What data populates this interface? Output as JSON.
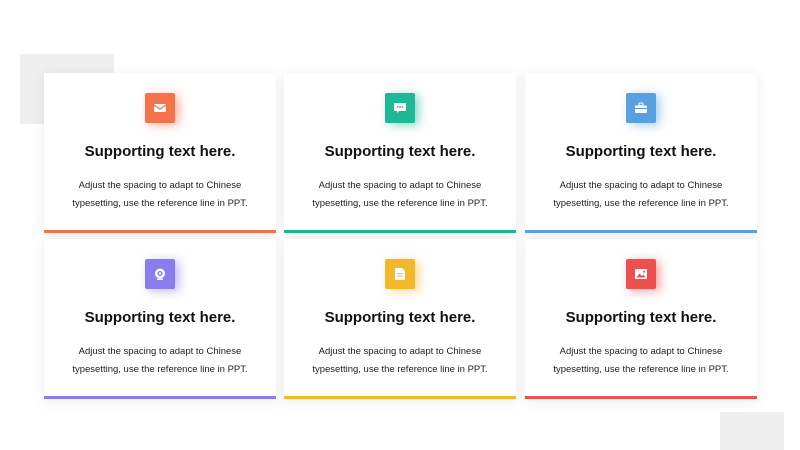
{
  "cards": [
    {
      "title": "Supporting text here.",
      "body": "Adjust the spacing to adapt to Chinese typesetting, use the reference line in PPT.",
      "icon": "envelope-icon",
      "color": "#F4734A"
    },
    {
      "title": "Supporting text here.",
      "body": "Adjust the spacing to adapt to Chinese typesetting, use the reference line in PPT.",
      "icon": "chat-bubble-icon",
      "color": "#1EB894"
    },
    {
      "title": "Supporting text here.",
      "body": "Adjust the spacing to adapt to Chinese typesetting, use the reference line in PPT.",
      "icon": "briefcase-icon",
      "color": "#5A9FE0"
    },
    {
      "title": "Supporting text here.",
      "body": "Adjust the spacing to adapt to Chinese typesetting, use the reference line in PPT.",
      "icon": "camera-icon",
      "color": "#8B7CEE"
    },
    {
      "title": "Supporting text here.",
      "body": "Adjust the spacing to adapt to Chinese typesetting, use the reference line in PPT.",
      "icon": "document-icon",
      "color": "#F1B92A"
    },
    {
      "title": "Supporting text here.",
      "body": "Adjust the spacing to adapt to Chinese typesetting, use the reference line in PPT.",
      "icon": "image-icon",
      "color": "#EE4F4F"
    }
  ]
}
